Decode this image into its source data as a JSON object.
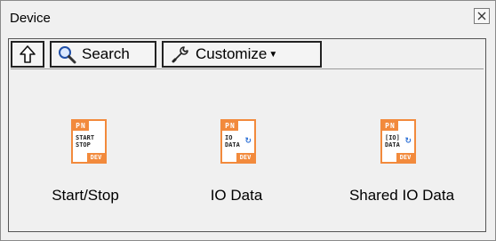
{
  "window": {
    "title": "Device"
  },
  "toolbar": {
    "search_label": "Search",
    "customize_label": "Customize",
    "up_icon": "up-arrow-icon",
    "search_icon": "magnifier-icon",
    "customize_icon": "wrench-icon",
    "dropdown_icon": "dropdown-caret-icon"
  },
  "items": [
    {
      "label": "Start/Stop",
      "badge": "PN",
      "icon_text": "START\nSTOP",
      "footer": "DEV",
      "icon": "start-stop-vi-icon"
    },
    {
      "label": "IO Data",
      "badge": "PN",
      "icon_text": "IO\nDATA",
      "footer": "DEV",
      "icon": "io-data-vi-icon"
    },
    {
      "label": "Shared IO Data",
      "badge": "PN",
      "icon_text": "[IO]\nDATA",
      "footer": "DEV",
      "icon": "shared-io-data-vi-icon"
    }
  ],
  "colors": {
    "accent": "#f28a3c",
    "sync": "#2a6fd6",
    "border": "#222222"
  }
}
